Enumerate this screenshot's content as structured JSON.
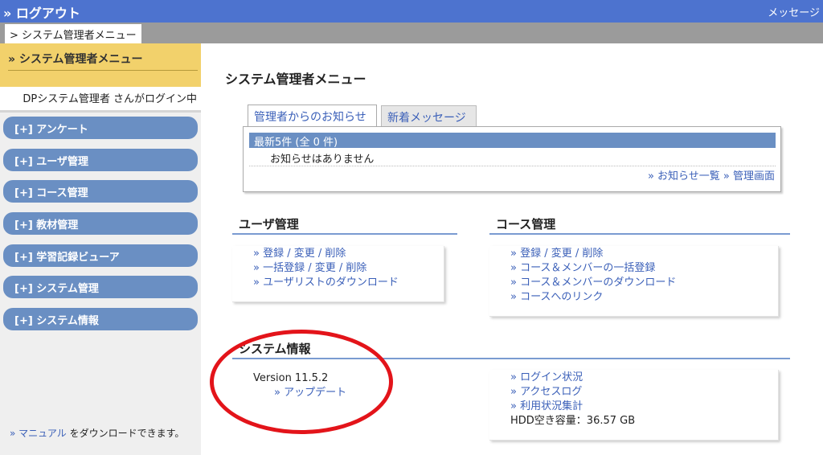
{
  "topbar": {
    "logout": "» ログアウト",
    "messages": "メッセージ"
  },
  "breadcrumb": "> システム管理者メニュー",
  "sidebar": {
    "header": "» システム管理者メニュー",
    "login_info": "DPシステム管理者 さんがログイン中",
    "items": [
      {
        "label": "[+] アンケート"
      },
      {
        "label": "[+] ユーザ管理"
      },
      {
        "label": "[+] コース管理"
      },
      {
        "label": "[+] 教材管理"
      },
      {
        "label": "[+] 学習記録ビューア"
      },
      {
        "label": "[+] システム管理"
      },
      {
        "label": "[+] システム情報"
      }
    ],
    "footer_link": "» マニュアル",
    "footer_text": " をダウンロードできます。"
  },
  "main": {
    "title": "システム管理者メニュー",
    "tabs": [
      {
        "label": "管理者からのお知らせ",
        "active": true
      },
      {
        "label": "新着メッセージ",
        "active": false
      }
    ],
    "notice": {
      "bar": "最新5件 (全 0 件)",
      "empty": "お知らせはありません",
      "link_list": "» お知らせ一覧",
      "link_admin": "» 管理画面"
    },
    "user_mgmt": {
      "title": "ユーザ管理",
      "links": [
        "» 登録 / 変更 / 削除",
        "» 一括登録 / 変更 / 削除",
        "» ユーザリストのダウンロード"
      ]
    },
    "course_mgmt": {
      "title": "コース管理",
      "links": [
        "» 登録 / 変更 / 削除",
        "» コース＆メンバーの一括登録",
        "» コース＆メンバーのダウンロード",
        "» コースへのリンク"
      ]
    },
    "system_info": {
      "title": "システム情報",
      "version": "Version 11.5.2",
      "update": "» アップデート",
      "links": [
        "» ログイン状況",
        "» アクセスログ",
        "» 利用状況集計"
      ],
      "hdd": "HDD空き容量：36.57 GB"
    }
  },
  "colors": {
    "topbar": "#4d73cf",
    "menu": "#6a8fc3",
    "sidebar_header": "#f2d16b",
    "annotation_circle": "#e3141a"
  }
}
